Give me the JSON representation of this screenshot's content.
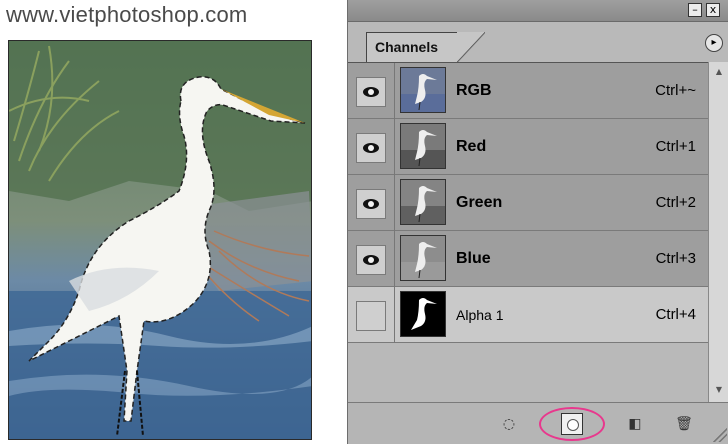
{
  "watermark": "www.vietphotoshop.com",
  "window": {
    "minimize_glyph": "–",
    "close_glyph": "x"
  },
  "panel": {
    "tab_label": "Channels",
    "menu_glyph": "▸"
  },
  "channels": [
    {
      "name": "RGB",
      "shortcut": "Ctrl+~",
      "visible": true
    },
    {
      "name": "Red",
      "shortcut": "Ctrl+1",
      "visible": true
    },
    {
      "name": "Green",
      "shortcut": "Ctrl+2",
      "visible": true
    },
    {
      "name": "Blue",
      "shortcut": "Ctrl+3",
      "visible": true
    },
    {
      "name": "Alpha 1",
      "shortcut": "Ctrl+4",
      "visible": false
    }
  ],
  "toolbar": {
    "load_selection_glyph": "◌",
    "new_channel_glyph": "◧",
    "delete_glyph": "🗑"
  },
  "scrollbar": {
    "up_glyph": "▲",
    "down_glyph": "▼"
  },
  "colors": {
    "highlight": "#e8388d",
    "row_bg": "#9e9e9e",
    "panel_bg": "#b9b9b9"
  }
}
